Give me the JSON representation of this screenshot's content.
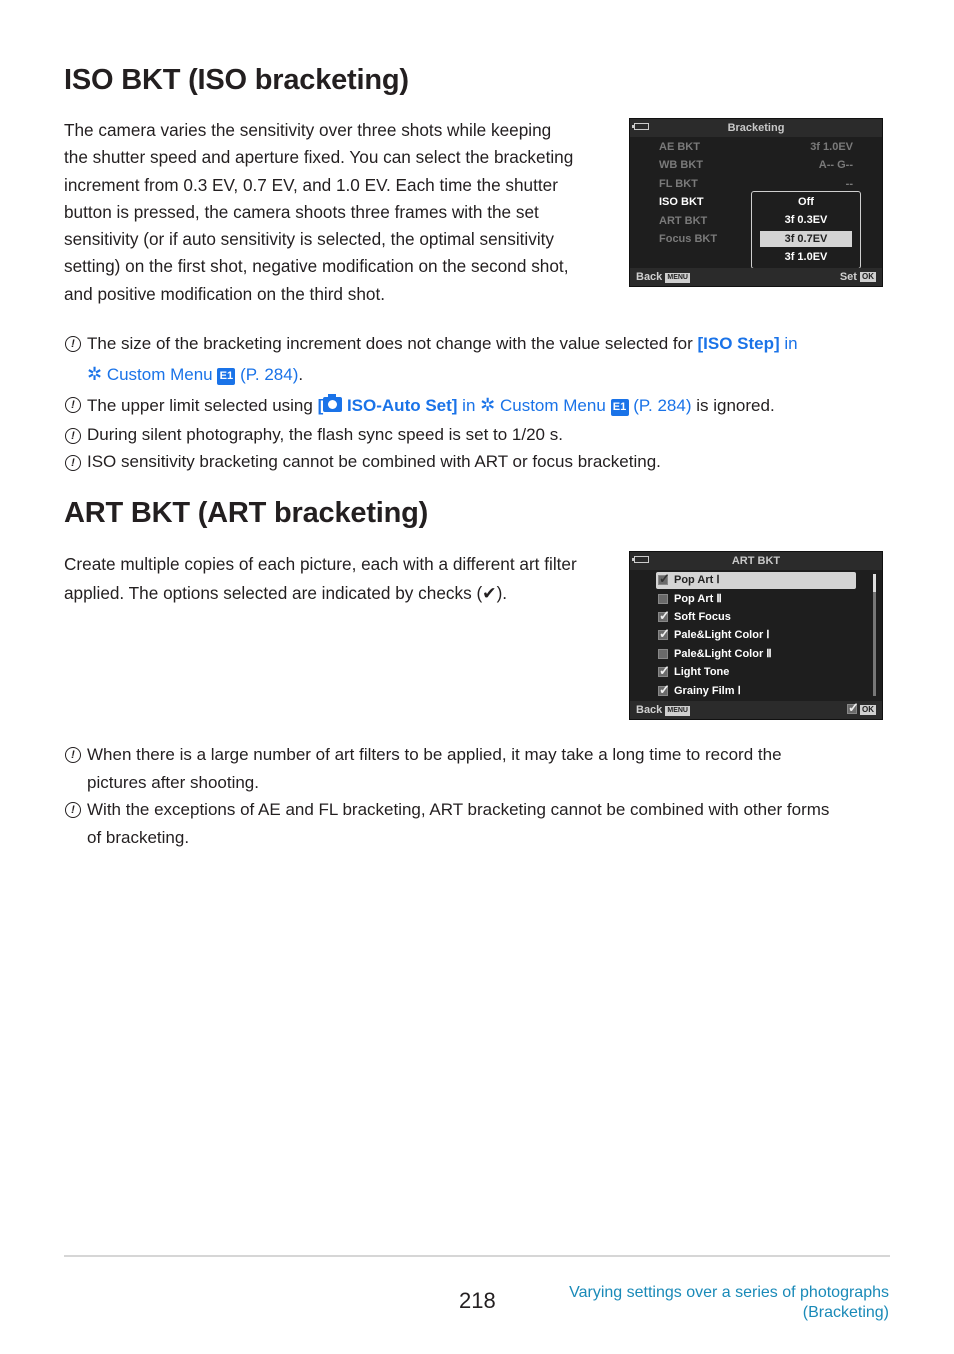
{
  "sections": {
    "iso": {
      "title": "ISO BKT (ISO bracketing)",
      "body_lines": [
        "The camera varies the sensitivity over three shots while keeping",
        "the shutter speed and aperture fixed. You can select the bracketing",
        "increment from 0.3 EV, 0.7 EV, and 1.0 EV. Each time the shutter",
        "button is pressed, the camera shoots three frames with the set",
        "sensitivity (or if auto sensitivity is selected, the optimal sensitivity",
        "setting) on the first shot, negative modification on the second shot,",
        "and positive modification on the third shot."
      ],
      "screen": {
        "title": "Bracketing",
        "items": [
          {
            "label": "AE BKT",
            "value": "3f 1.0EV"
          },
          {
            "label": "WB BKT",
            "value": "A-- G--"
          },
          {
            "label": "FL BKT",
            "value": "--"
          },
          {
            "label": "ISO BKT",
            "value": ""
          },
          {
            "label": "ART BKT",
            "value": ""
          },
          {
            "label": "Focus BKT",
            "value": ""
          }
        ],
        "active_item": "ISO BKT",
        "options": [
          "Off",
          "3f 0.3EV",
          "3f 0.7EV",
          "3f 1.0EV"
        ],
        "selected_option": "3f 0.7EV",
        "footer_left": "Back",
        "footer_left_badge": "MENU",
        "footer_right": "Set",
        "footer_right_badge": "OK"
      },
      "notes": {
        "n1_text": "The size of the bracketing increment does not change with the value selected for ",
        "n1_link_bold": "[ISO Step]",
        "n1_link_in": " in",
        "n1_custom": " Custom Menu ",
        "n1_tab": "E1",
        "n1_page": " (P. 284)",
        "n1_end": ".",
        "n2_text": "The upper limit selected using ",
        "n2_link_open": "[",
        "n2_link_bold": " ISO-Auto Set]",
        "n2_link_in": " in ",
        "n2_custom": " Custom Menu ",
        "n2_tab": "E1",
        "n2_page": " (P. 284)",
        "n2_end": " is ignored.",
        "n3": "During silent photography, the flash sync speed is set to 1/20 s.",
        "n4": "ISO sensitivity bracketing cannot be combined with ART or focus bracketing."
      }
    },
    "art": {
      "title": "ART BKT (ART bracketing)",
      "body_line1": "Create multiple copies of each picture, each with a different art filter",
      "body_line2_pre": "applied. The options selected are indicated by checks (",
      "body_check": "✔",
      "body_line2_post": ").",
      "screen": {
        "title": "ART BKT",
        "items": [
          {
            "label": "Pop Art Ⅰ",
            "checked": true
          },
          {
            "label": "Pop Art Ⅱ",
            "checked": false
          },
          {
            "label": "Soft Focus",
            "checked": true
          },
          {
            "label": "Pale&Light Color Ⅰ",
            "checked": true
          },
          {
            "label": "Pale&Light Color Ⅱ",
            "checked": false
          },
          {
            "label": "Light Tone",
            "checked": true
          },
          {
            "label": "Grainy Film Ⅰ",
            "checked": true
          }
        ],
        "selected_item": "Pop Art Ⅰ",
        "footer_left": "Back",
        "footer_left_badge": "MENU",
        "footer_right_badge": "OK"
      },
      "notes": {
        "n1_line1": "When there is a large number of art filters to be applied, it may take a long time to record the",
        "n1_line2": "pictures after shooting.",
        "n2_line1": "With the exceptions of AE and FL bracketing, ART bracketing cannot be combined with other forms",
        "n2_line2": "of bracketing."
      }
    }
  },
  "icons": {
    "warning": "!",
    "gear": "✲"
  },
  "footer": {
    "page_number": "218",
    "section_line1": "Varying settings over a series of photographs",
    "section_line2": "(Bracketing)"
  },
  "colors": {
    "link": "#1a73e8",
    "footer_link": "#1a8ab8",
    "text": "#231f20"
  }
}
